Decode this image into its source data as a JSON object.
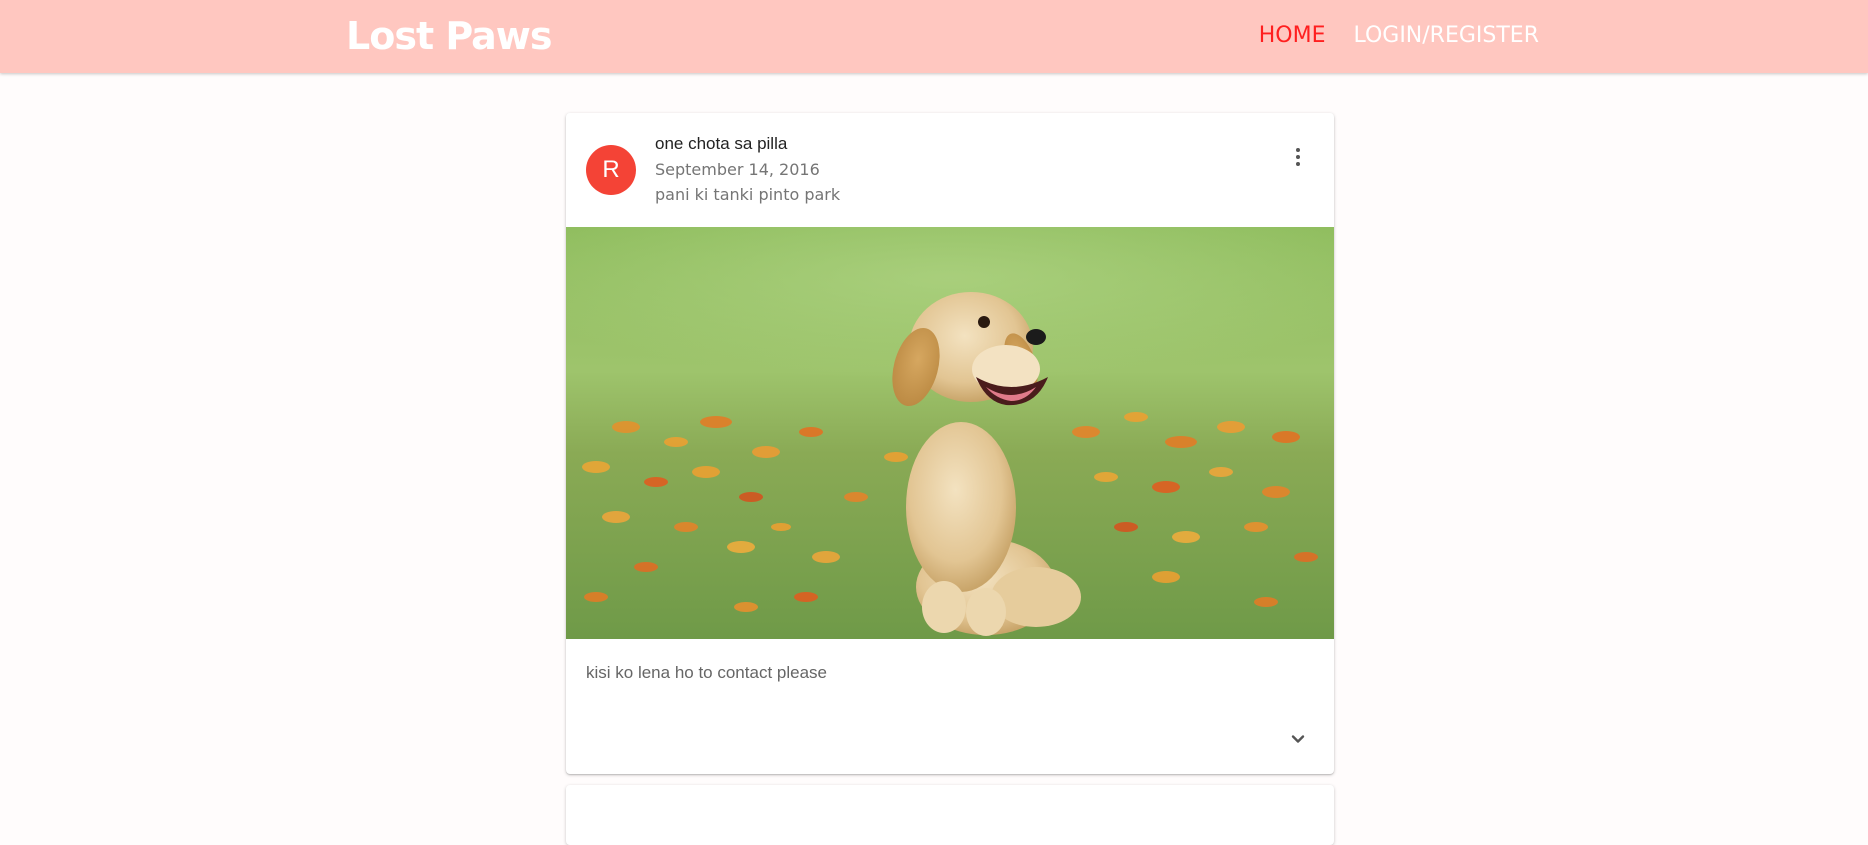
{
  "header": {
    "brand": "Lost Paws",
    "nav": {
      "home": "HOME",
      "login": "LOGIN/REGISTER"
    }
  },
  "post": {
    "avatar_letter": "R",
    "title": "one chota sa pilla",
    "date": "September 14, 2016",
    "location": "pani ki tanki pinto park",
    "description": "kisi ko lena ho to contact please",
    "image_subject": "golden retriever puppy sitting in grass with orange flowers",
    "more_icon": "more-vert-icon",
    "expand_icon": "chevron-down-icon"
  },
  "colors": {
    "appbar": "#ffc7c0",
    "nav_active": "#ff1f1f",
    "avatar": "#f44336"
  }
}
